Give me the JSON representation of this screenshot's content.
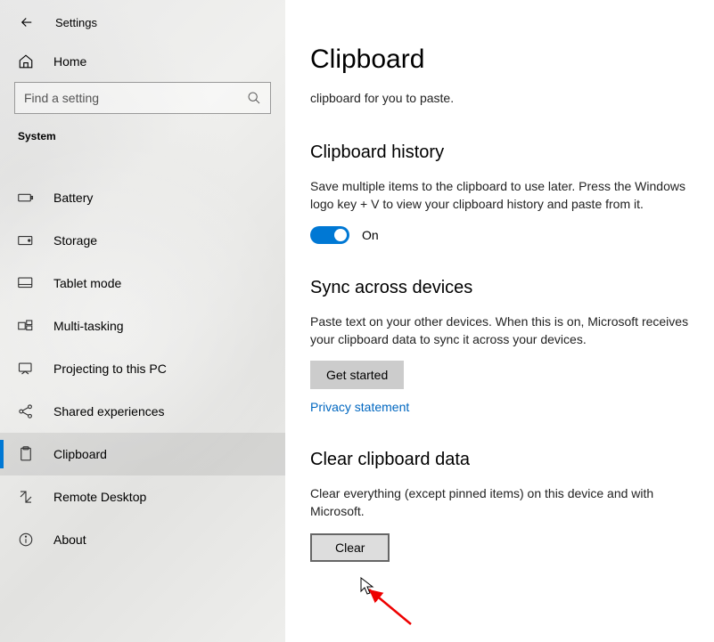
{
  "header": {
    "title": "Settings"
  },
  "home": {
    "label": "Home"
  },
  "search": {
    "placeholder": "Find a setting"
  },
  "category": "System",
  "sidebar": {
    "items": [
      {
        "label": "Battery"
      },
      {
        "label": "Storage"
      },
      {
        "label": "Tablet mode"
      },
      {
        "label": "Multi-tasking"
      },
      {
        "label": "Projecting to this PC"
      },
      {
        "label": "Shared experiences"
      },
      {
        "label": "Clipboard"
      },
      {
        "label": "Remote Desktop"
      },
      {
        "label": "About"
      }
    ]
  },
  "main": {
    "title": "Clipboard",
    "intro_fragment": "clipboard for you to paste.",
    "history": {
      "title": "Clipboard history",
      "text": "Save multiple items to the clipboard to use later. Press the Windows logo key + V to view your clipboard history and paste from it.",
      "toggle_label": "On"
    },
    "sync": {
      "title": "Sync across devices",
      "text": "Paste text on your other devices. When this is on, Microsoft receives your clipboard data to sync it across your devices.",
      "button": "Get started",
      "link": "Privacy statement"
    },
    "clear": {
      "title": "Clear clipboard data",
      "text": "Clear everything (except pinned items) on this device and with Microsoft.",
      "button": "Clear"
    }
  }
}
